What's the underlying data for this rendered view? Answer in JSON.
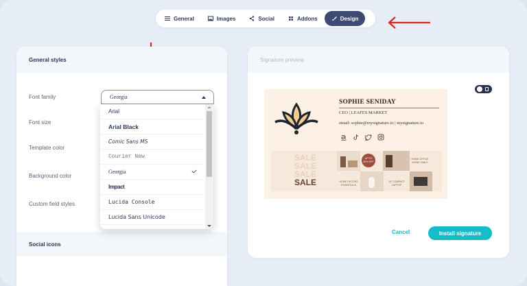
{
  "tabs": [
    {
      "label": "General",
      "icon": "menu-icon",
      "active": false
    },
    {
      "label": "Images",
      "icon": "image-icon",
      "active": false
    },
    {
      "label": "Social",
      "icon": "share-icon",
      "active": false
    },
    {
      "label": "Addons",
      "icon": "grid-icon",
      "active": false
    },
    {
      "label": "Design",
      "icon": "brush-icon",
      "active": true
    }
  ],
  "left_panel": {
    "title": "General styles",
    "fields": {
      "font_family": "Font family",
      "font_size": "Font size",
      "template_color": "Template color",
      "background_color": "Background color",
      "custom_field_styles": "Custom field styles"
    },
    "font_select": {
      "value": "Georgia",
      "options": [
        {
          "label": "Arial"
        },
        {
          "label": "Arial Black"
        },
        {
          "label": "Comic Sans MS"
        },
        {
          "label": "Courier New"
        },
        {
          "label": "Georgia",
          "selected": true
        },
        {
          "label": "Impact"
        },
        {
          "label": "Lucida Console"
        },
        {
          "label": "Lucida Sans Unicode"
        }
      ]
    },
    "social_icons_title": "Social icons"
  },
  "right_panel": {
    "title": "Signature preview",
    "signature": {
      "name": "SOPHIE SENIDAY",
      "role": "CEO | LEAFES MARKET",
      "contact": "email: sophie@mysignature.io | mysignature.io",
      "social_icons": [
        "amazon-icon",
        "tiktok-icon",
        "twitter-icon",
        "instagram-icon"
      ],
      "banner": {
        "sale_words": [
          "SALE",
          "SALE",
          "SALE",
          "SALE"
        ],
        "tiles": [
          "UP TO 30% OFF",
          "HOME OFFICE WORK TABLE",
          "HOME DECORS ESSENTIALS",
          "15\" COMPACT LAPTOP"
        ]
      }
    },
    "cancel_label": "Cancel",
    "install_label": "Install signature"
  },
  "colors": {
    "accent": "#17bcc9",
    "active_tab": "#3d4b74",
    "annotation_arrow": "#d9261c",
    "signature_bg": "#fdf1e6"
  }
}
